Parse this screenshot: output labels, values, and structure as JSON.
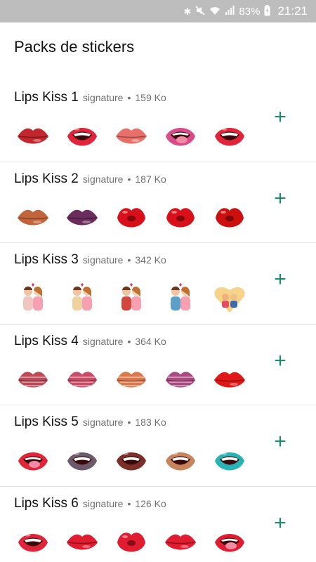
{
  "status_bar": {
    "battery_text": "83%",
    "time": "21:21",
    "icons": [
      "bluetooth-icon",
      "mute-icon",
      "wifi-icon",
      "signal-icon",
      "battery-icon"
    ]
  },
  "header": {
    "title": "Packs de stickers"
  },
  "packs": [
    {
      "name": "Lips Kiss  1",
      "author": "signature",
      "separator": "•",
      "size": "159 Ko",
      "add_label": "+",
      "stickers": [
        {
          "kind": "lips",
          "color": "#c1272d"
        },
        {
          "kind": "mouth",
          "color": "#e0243a"
        },
        {
          "kind": "lips",
          "color": "#e8706a"
        },
        {
          "kind": "tongue",
          "color": "#d94c8a"
        },
        {
          "kind": "mouth",
          "color": "#e0243a"
        }
      ]
    },
    {
      "name": "Lips Kiss  2",
      "author": "signature",
      "separator": "•",
      "size": "187 Ko",
      "add_label": "+",
      "stickers": [
        {
          "kind": "lips",
          "color": "#c2643c"
        },
        {
          "kind": "lips",
          "color": "#6a2c5c"
        },
        {
          "kind": "kiss",
          "color": "#d8101a"
        },
        {
          "kind": "kiss",
          "color": "#d8101a"
        },
        {
          "kind": "kiss",
          "color": "#cc1010"
        }
      ]
    },
    {
      "name": "Lips Kiss  3",
      "author": "signature",
      "separator": "•",
      "size": "342 Ko",
      "add_label": "+",
      "stickers": [
        {
          "kind": "couple",
          "color": "#f2c6c0"
        },
        {
          "kind": "couple",
          "color": "#f0d2a0"
        },
        {
          "kind": "couple",
          "color": "#d2483c"
        },
        {
          "kind": "couple",
          "color": "#5aa0c8"
        },
        {
          "kind": "heart",
          "color": "#f6d28a"
        }
      ]
    },
    {
      "name": "Lips Kiss  4",
      "author": "signature",
      "separator": "•",
      "size": "364 Ko",
      "add_label": "+",
      "stickers": [
        {
          "kind": "print",
          "color": "#b02a3a"
        },
        {
          "kind": "print",
          "color": "#c22a4a"
        },
        {
          "kind": "print",
          "color": "#d4602a"
        },
        {
          "kind": "print",
          "color": "#9c2a6a"
        },
        {
          "kind": "lips",
          "color": "#e01818"
        }
      ]
    },
    {
      "name": "Lips Kiss  5",
      "author": "signature",
      "separator": "•",
      "size": "183 Ko",
      "add_label": "+",
      "stickers": [
        {
          "kind": "tongue",
          "color": "#e0243a"
        },
        {
          "kind": "mouth",
          "color": "#6a5a6a"
        },
        {
          "kind": "mouth",
          "color": "#7a3028"
        },
        {
          "kind": "mouth",
          "color": "#c8845a"
        },
        {
          "kind": "mouth",
          "color": "#28b4b4"
        }
      ]
    },
    {
      "name": "Lips Kiss  6",
      "author": "signature",
      "separator": "•",
      "size": "126 Ko",
      "add_label": "+",
      "stickers": [
        {
          "kind": "mouth",
          "color": "#e0243a"
        },
        {
          "kind": "lips",
          "color": "#e01c30"
        },
        {
          "kind": "kiss",
          "color": "#e01c30"
        },
        {
          "kind": "lips",
          "color": "#e01c30"
        },
        {
          "kind": "tongue",
          "color": "#e01c30"
        }
      ]
    }
  ]
}
